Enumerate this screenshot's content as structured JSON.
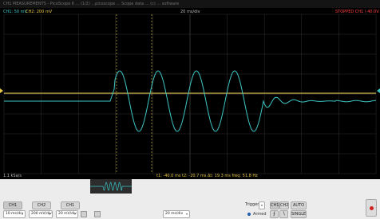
{
  "window": {
    "title": "CH1 MEASUREMENTS - PicoScope 6 ... (1/2) ...picoscope ... Scope data ... (c) ... software"
  },
  "screen": {
    "ch1_label": "CH1: 50 mV",
    "ch2_label": "CH2: 200 mV",
    "timebase_label": "20 ms/div",
    "status_label": "STOPPED CH1 \\ 40.0V",
    "rate_label": "1.1 kSa/s",
    "measure_label": "t1: -40.0 ms   t2: -20.7 ms   Δt: 19.3 ms   freq: 51.8 Hz"
  },
  "colors": {
    "ch1": "#e8c84a",
    "ch2": "#3ec6c6",
    "grid": "#3a3a3a",
    "status": "#ff4040"
  },
  "controls": {
    "ch1_label": "CH1",
    "ch2_label": "CH2",
    "ch1_alt_label": "CH1",
    "timebase_value": "10 ms/div",
    "ch1_scale": "200 mV/div",
    "ch2_scale": "20 mV/div",
    "zoom_value": "20 ms/div",
    "trigger_label": "Trigger",
    "trig_ch1": "CH1",
    "trig_ch2": "CH2",
    "auto_label": "AUTO",
    "armed_label": "Armed",
    "single_label": "SINGLE"
  },
  "icons": {
    "run": "run-icon",
    "dropdown": "chevron-down-icon",
    "edge_rise": "rising-edge-icon",
    "edge_fall": "falling-edge-icon"
  }
}
